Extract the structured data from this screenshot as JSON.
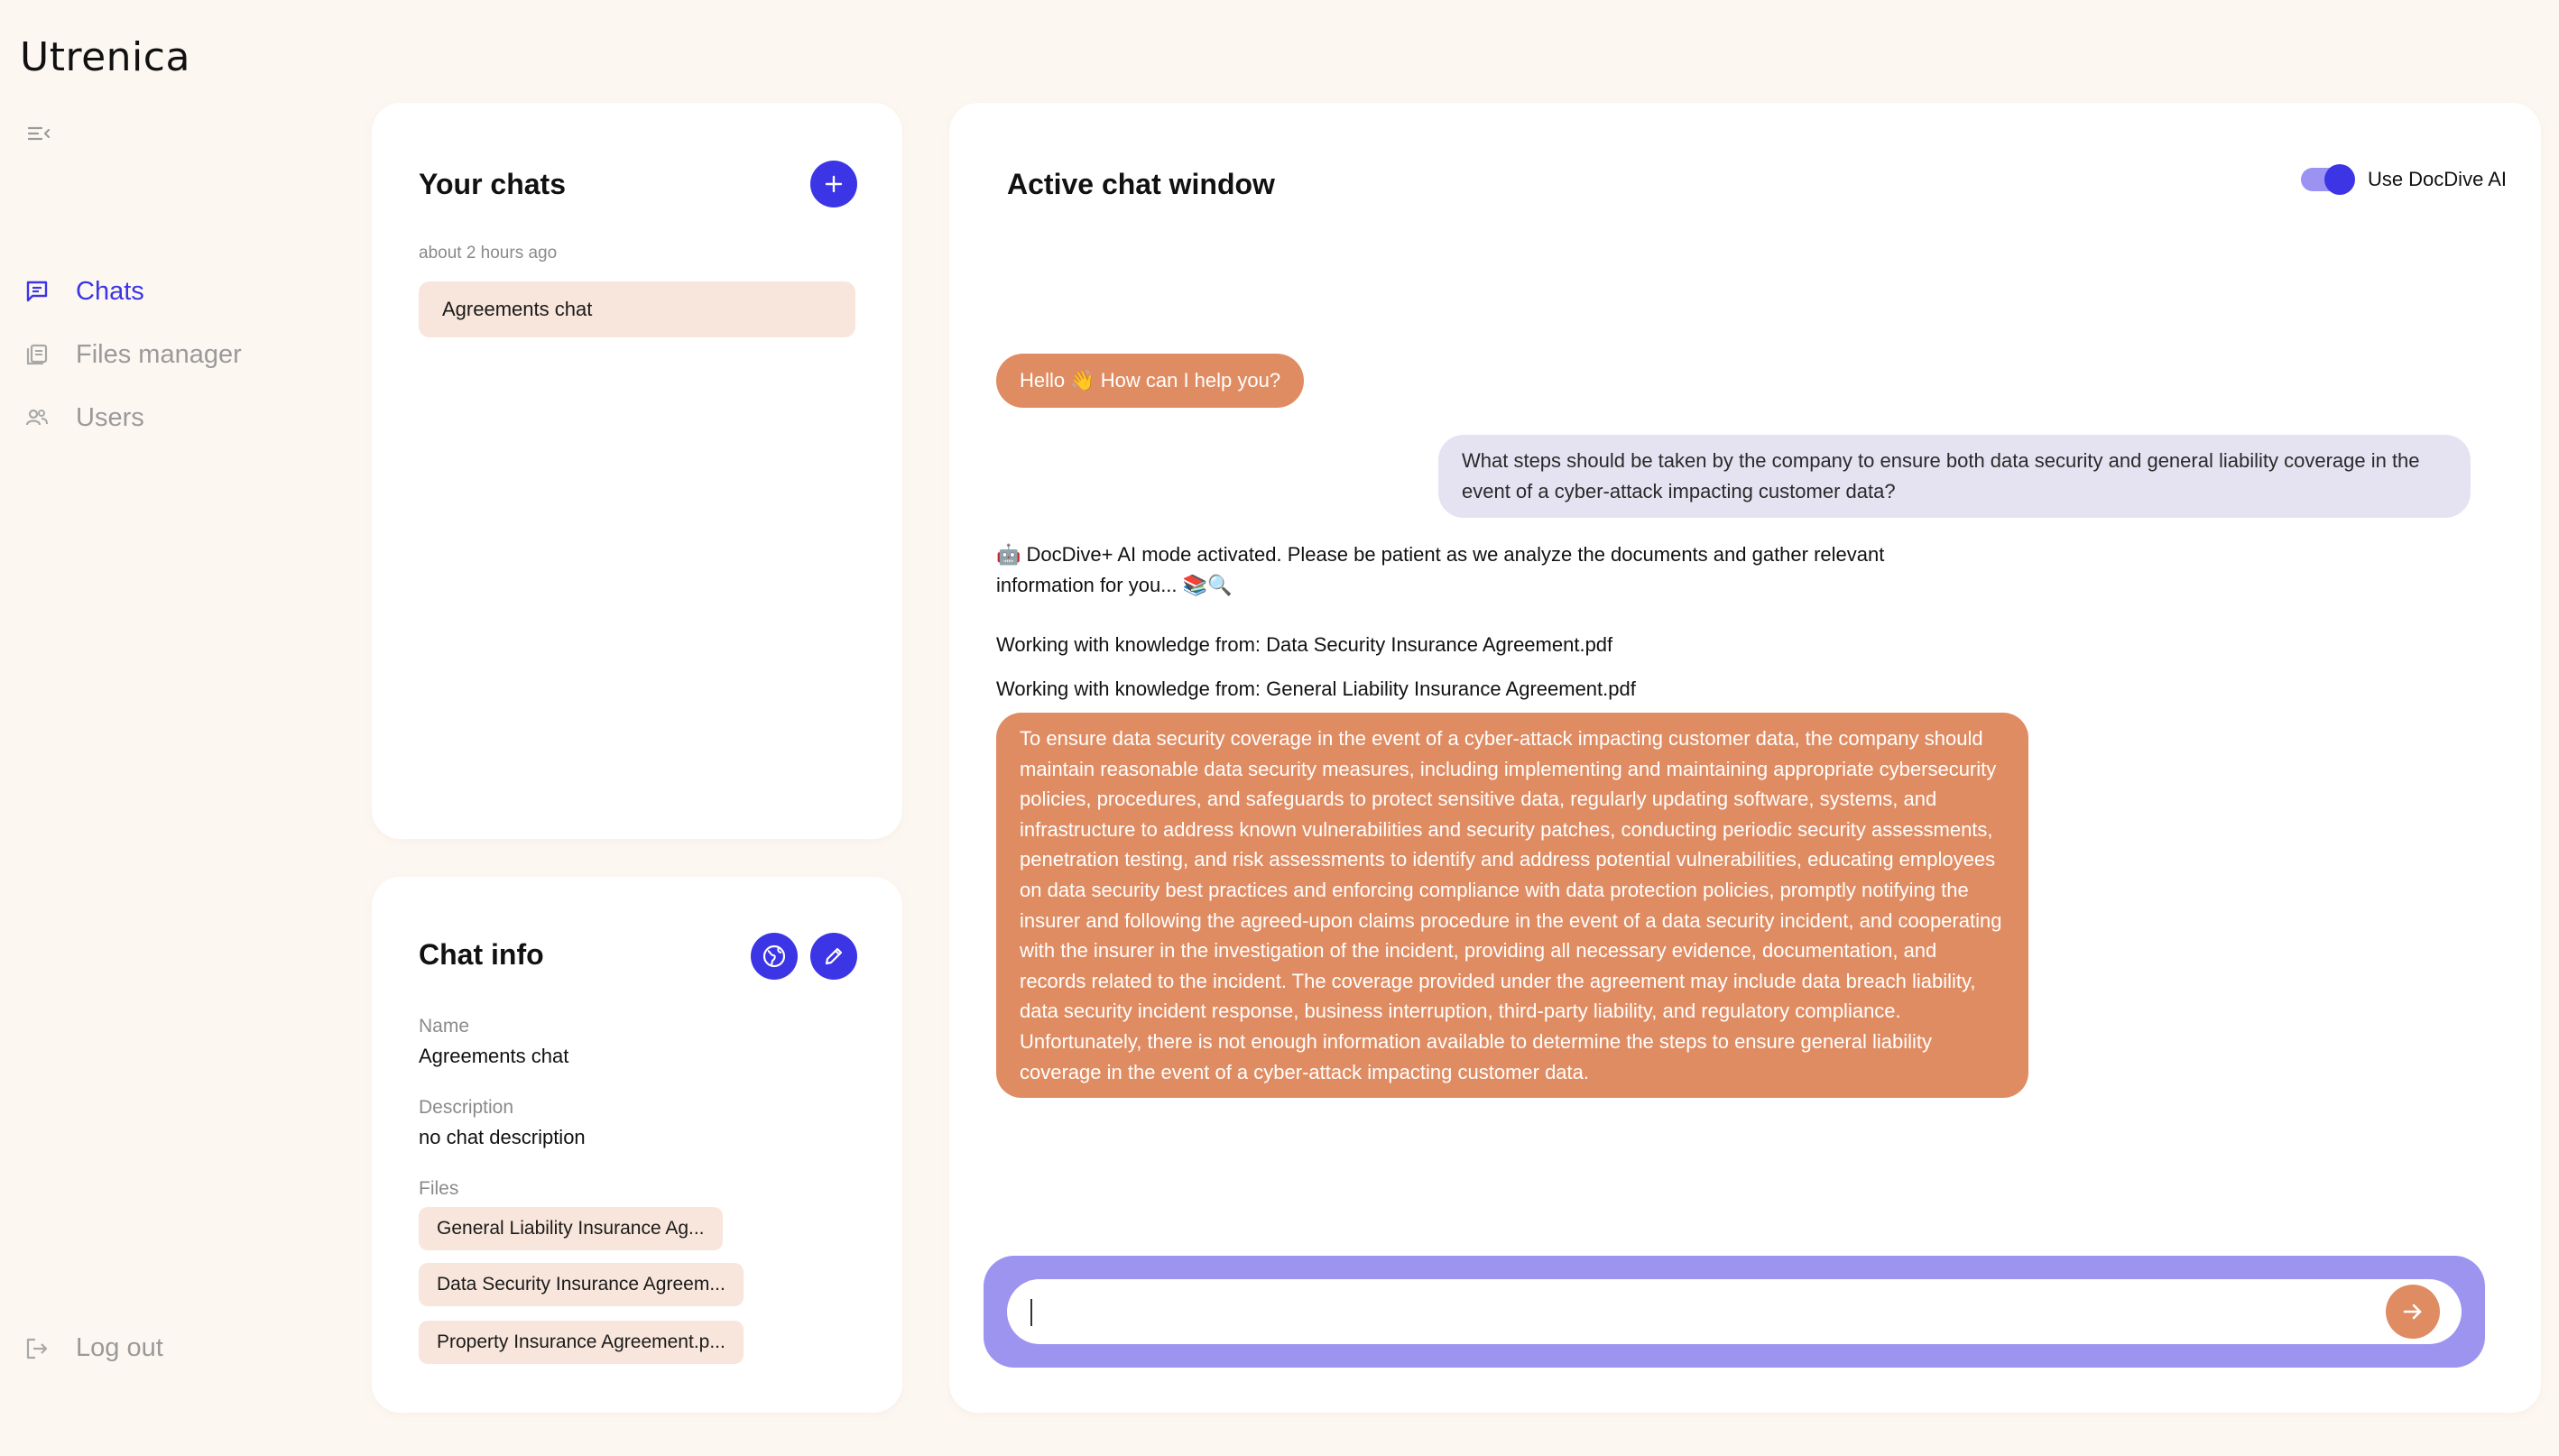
{
  "app": {
    "logo": "Utrenica"
  },
  "sidebar": {
    "items": [
      {
        "label": "Chats",
        "icon": "chat-icon",
        "active": true
      },
      {
        "label": "Files manager",
        "icon": "files-icon",
        "active": false
      },
      {
        "label": "Users",
        "icon": "users-icon",
        "active": false
      }
    ],
    "logout_label": "Log out"
  },
  "chats_panel": {
    "title": "Your chats",
    "group_time": "about 2 hours ago",
    "items": [
      {
        "label": "Agreements chat"
      }
    ]
  },
  "chat_info": {
    "title": "Chat info",
    "name_label": "Name",
    "name_value": "Agreements chat",
    "description_label": "Description",
    "description_value": "no chat description",
    "files_label": "Files",
    "files": [
      "General Liability Insurance Ag...",
      "Data Security Insurance Agreem...",
      "Property Insurance Agreement.p..."
    ]
  },
  "active_chat": {
    "title": "Active chat window",
    "toggle_label": "Use DocDive AI",
    "toggle_on": true,
    "greeting": "Hello 👋 How can I help you?",
    "user_question": "What steps should be taken by the company to ensure both data security and general liability coverage in the event of a cyber-attack impacting customer data?",
    "system_messages": [
      "🤖 DocDive+ AI mode activated. Please be patient as we analyze the documents and gather relevant information for you... 📚🔍",
      "Working with knowledge from: Data Security Insurance Agreement.pdf",
      "Working with knowledge from: General Liability Insurance Agreement.pdf"
    ],
    "answer": "To ensure data security coverage in the event of a cyber-attack impacting customer data, the company should maintain reasonable data security measures, including implementing and maintaining appropriate cybersecurity policies, procedures, and safeguards to protect sensitive data, regularly updating software, systems, and infrastructure to address known vulnerabilities and security patches, conducting periodic security assessments, penetration testing, and risk assessments to identify and address potential vulnerabilities, educating employees on data security best practices and enforcing compliance with data protection policies, promptly notifying the insurer and following the agreed-upon claims procedure in the event of a data security incident, and cooperating with the insurer in the investigation of the incident, providing all necessary evidence, documentation, and records related to the incident. The coverage provided under the agreement may include data breach liability, data security incident response, business interruption, third-party liability, and regulatory compliance. Unfortunately, there is not enough information available to determine the steps to ensure general liability coverage in the event of a cyber-attack impacting customer data.",
    "input_value": "",
    "input_placeholder": ""
  },
  "colors": {
    "accent": "#3b35e6",
    "ai_bubble": "#e08c62",
    "user_bubble": "#e5e3f2",
    "composer": "#9c94ef",
    "chip": "#f8e6dc",
    "background": "#fdf7f2"
  }
}
